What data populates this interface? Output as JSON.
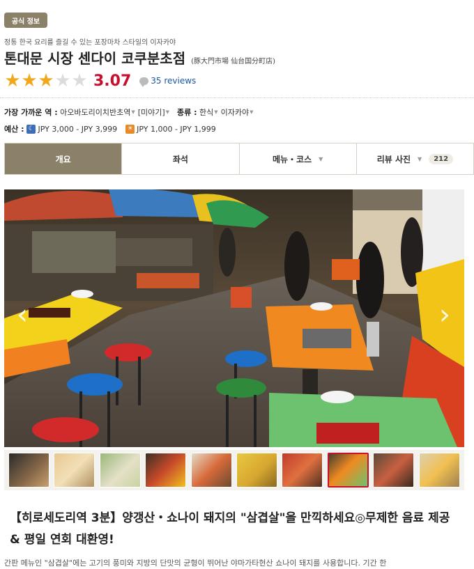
{
  "badge": "공식 정보",
  "subtitle": "정통 한국 요리를 즐길 수 있는 포장마차 스타일의 이자카야",
  "title": "톤대문 시장 센다이 코쿠분초점",
  "title_alt": "(豚大門市場 仙台国分町店)",
  "rating": {
    "stars": 3,
    "max_stars": 5,
    "score": "3.07",
    "reviews_label": "35 reviews",
    "star_on_color": "#f0a81c",
    "star_off_color": "#dcdcdc",
    "score_color": "#c8102e"
  },
  "info": {
    "station_label": "가장 가까운 역 :",
    "station_value": "아오바도리이치반초역",
    "area_value": "[미야기]",
    "genre_label": "종류 :",
    "genre_values": [
      "한식",
      "이자카야"
    ],
    "budget_label": "예산 :",
    "budget_dinner": "JPY 3,000 - JPY 3,999",
    "budget_lunch": "JPY 1,000 - JPY 1,999"
  },
  "tabs": [
    {
      "label": "개요",
      "active": true
    },
    {
      "label": "좌석",
      "active": false
    },
    {
      "label": "메뉴・코스",
      "active": false
    },
    {
      "label": "리뷰 사진",
      "active": false,
      "count": "212"
    }
  ],
  "accent_color": "#8b8068",
  "thumbnails": [
    {
      "icon": "photo-thumb",
      "selected": false
    },
    {
      "icon": "photo-thumb",
      "selected": false
    },
    {
      "icon": "photo-thumb",
      "selected": false
    },
    {
      "icon": "photo-thumb",
      "selected": false
    },
    {
      "icon": "photo-thumb",
      "selected": false
    },
    {
      "icon": "photo-thumb",
      "selected": false
    },
    {
      "icon": "photo-thumb",
      "selected": false
    },
    {
      "icon": "photo-thumb",
      "selected": true
    },
    {
      "icon": "photo-thumb",
      "selected": false
    },
    {
      "icon": "photo-thumb",
      "selected": false
    }
  ],
  "headline": "【히로세도리역 3분】양갱산・쇼나이 돼지의 \"삼겹살\"을 만끽하세요◎무제한 음료 제공 & 평일 연회 대환영!",
  "body": "간판 메뉴인 \"삼겹살\"에는 고기의 풍미와 지방의 단맛의 균형이 뛰어난 야마가타현산 쇼나이 돼지를 사용합니다. 기간 한"
}
